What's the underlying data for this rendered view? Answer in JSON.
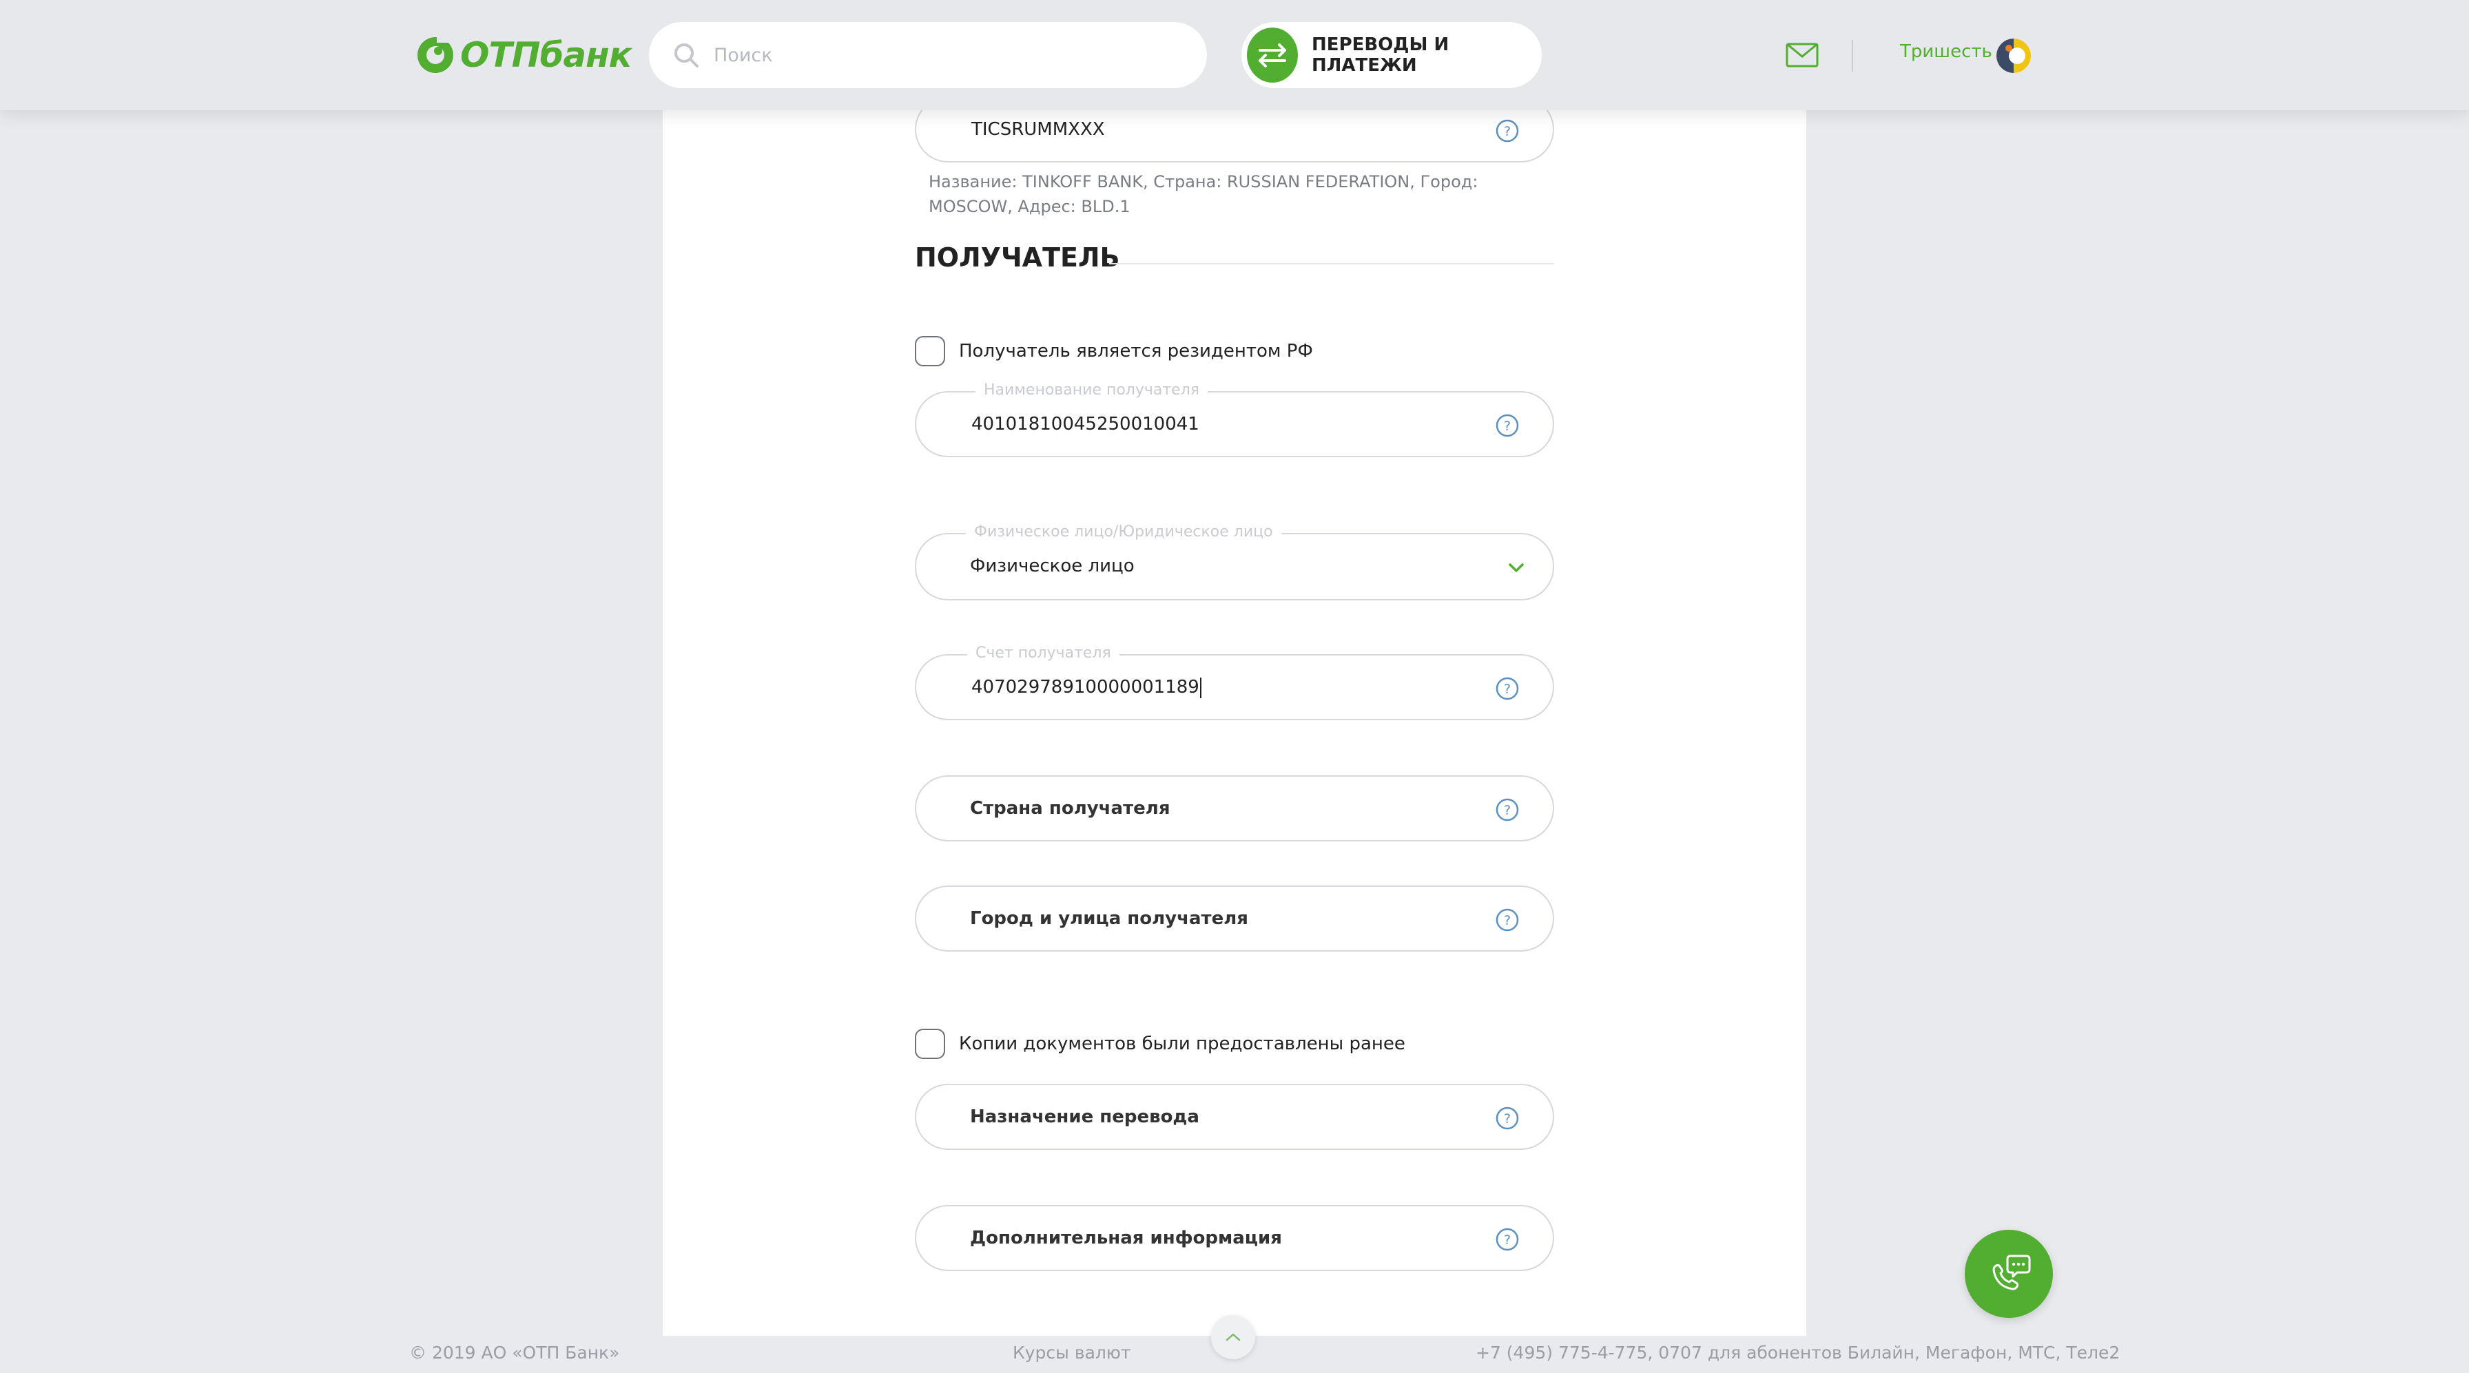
{
  "header": {
    "logo_text": "ОТПбанк",
    "search_placeholder": "Поиск",
    "transfers_label": "ПЕРЕВОДЫ И ПЛАТЕЖИ",
    "user_name": "Тришесть"
  },
  "form": {
    "swift_value": "TICSRUMMXXX",
    "bank_info": "Название: TINKOFF BANK, Страна: RUSSIAN FEDERATION, Город: MOSCOW, Адрес: BLD.1",
    "section_title": "ПОЛУЧАТЕЛЬ",
    "resident_checkbox_label": "Получатель является резидентом РФ",
    "recipient_name_label": "Наименование получателя",
    "recipient_name_value": "40101810045250010041",
    "person_type_label": "Физическое лицо/Юридическое лицо",
    "person_type_value": "Физическое лицо",
    "account_label": "Счет получателя",
    "account_value": "40702978910000001189",
    "country_label": "Страна получателя",
    "city_label": "Город и улица получателя",
    "docs_checkbox_label": "Копии документов были предоставлены ранее",
    "purpose_label": "Назначение перевода",
    "additional_label": "Дополнительная информация"
  },
  "footer": {
    "copyright": "© 2019 АО «ОТП Банк»",
    "rates_link": "Курсы валют",
    "phones": "+7 (495) 775-4-775,  0707 для абонентов Билайн, Мегафон, МТС, Теле2"
  },
  "colors": {
    "brand_green": "#52ae30",
    "background": "#e9eaee",
    "help_blue": "#5b8fbf"
  },
  "icons": {
    "search": "search-icon",
    "transfers": "transfer-arrows-icon",
    "mail": "mail-icon",
    "help": "help-icon",
    "chevron": "chevron-down-icon",
    "scroll_up": "chevron-up-icon",
    "chat": "phone-chat-icon"
  }
}
